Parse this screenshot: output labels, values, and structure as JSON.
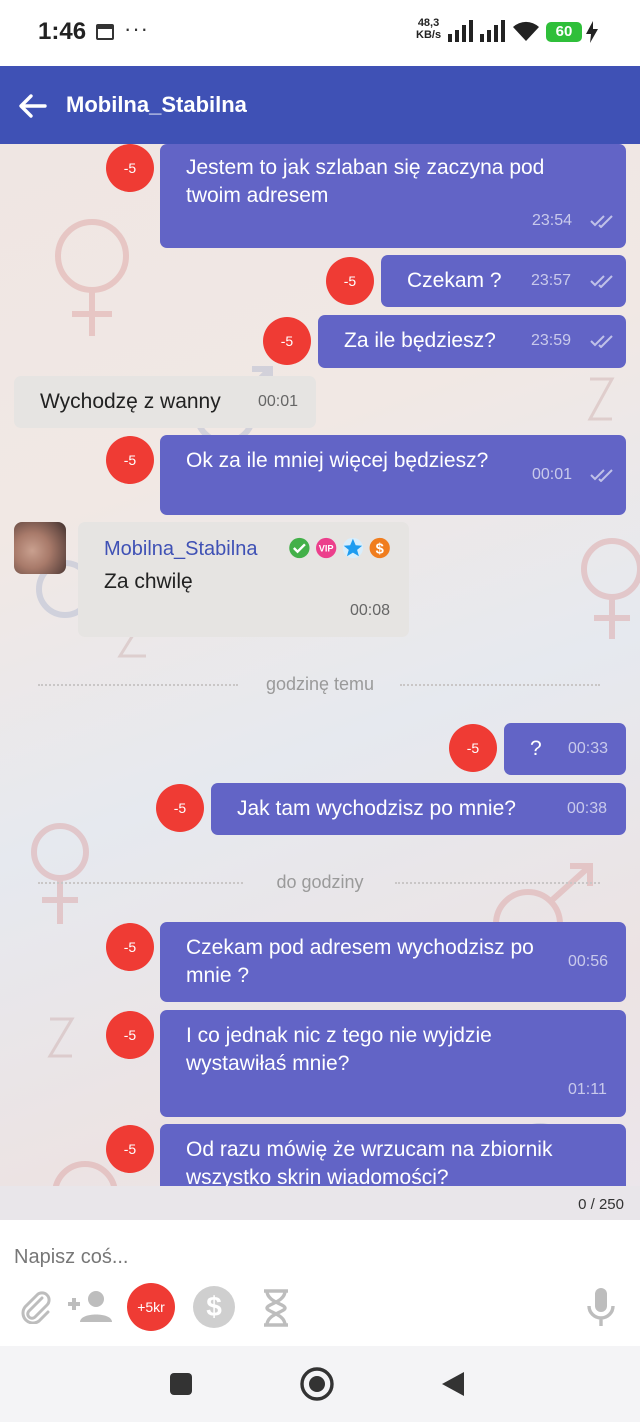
{
  "status_bar": {
    "time": "1:46",
    "speed_value": "48,3",
    "speed_unit": "KB/s",
    "battery": "60"
  },
  "header": {
    "title": "Mobilna_Stabilna"
  },
  "messages": [
    {
      "text": "Jestem to jak szlaban się zaczyna pod twoim adresem",
      "time": "23:54",
      "badge": "-5"
    },
    {
      "text": "Czekam ?",
      "time": "23:57",
      "badge": "-5"
    },
    {
      "text": "Za ile będziesz?",
      "time": "23:59",
      "badge": "-5"
    },
    {
      "text": "Wychodzę z wanny",
      "time": "00:01"
    },
    {
      "text": "Ok za ile mniej więcej będziesz?",
      "time": "00:01",
      "badge": "-5"
    },
    {
      "sender": "Mobilna_Stabilna",
      "text": "Za chwilę",
      "time": "00:08"
    },
    {
      "text": "?",
      "time": "00:33",
      "badge": "-5"
    },
    {
      "text": "Jak tam wychodzisz po mnie?",
      "time": "00:38",
      "badge": "-5"
    },
    {
      "text": "Czekam pod adresem wychodzisz po mnie ?",
      "time": "00:56",
      "badge": "-5"
    },
    {
      "text": "I co jednak nic z tego nie wyjdzie wystawiłaś mnie?",
      "time": "01:11",
      "badge": "-5"
    },
    {
      "text": "Od razu mówię że wrzucam na zbiornik wszystko skrin wiadomości?",
      "badge": "-5"
    }
  ],
  "dividers": [
    "godzinę temu",
    "do godziny"
  ],
  "char_counter": "0 / 250",
  "input": {
    "placeholder": "Napisz coś...",
    "credit_button": "+5kr",
    "dollar_button": "$"
  },
  "icons": [
    "back-arrow-icon",
    "calendar-icon",
    "signal-icon",
    "wifi-icon",
    "battery-icon",
    "charging-icon",
    "double-check-icon",
    "verified-icon",
    "vip-icon",
    "star-icon",
    "coin-icon",
    "attachment-icon",
    "add-person-icon",
    "hourglass-icon",
    "microphone-icon",
    "recent-apps-icon",
    "home-icon",
    "back-icon"
  ],
  "colors": {
    "app_bar": "#3f51b5",
    "outgoing_bubble": "#6264c6",
    "incoming_bubble": "#e6e4e2",
    "badge": "#ef3b34"
  }
}
